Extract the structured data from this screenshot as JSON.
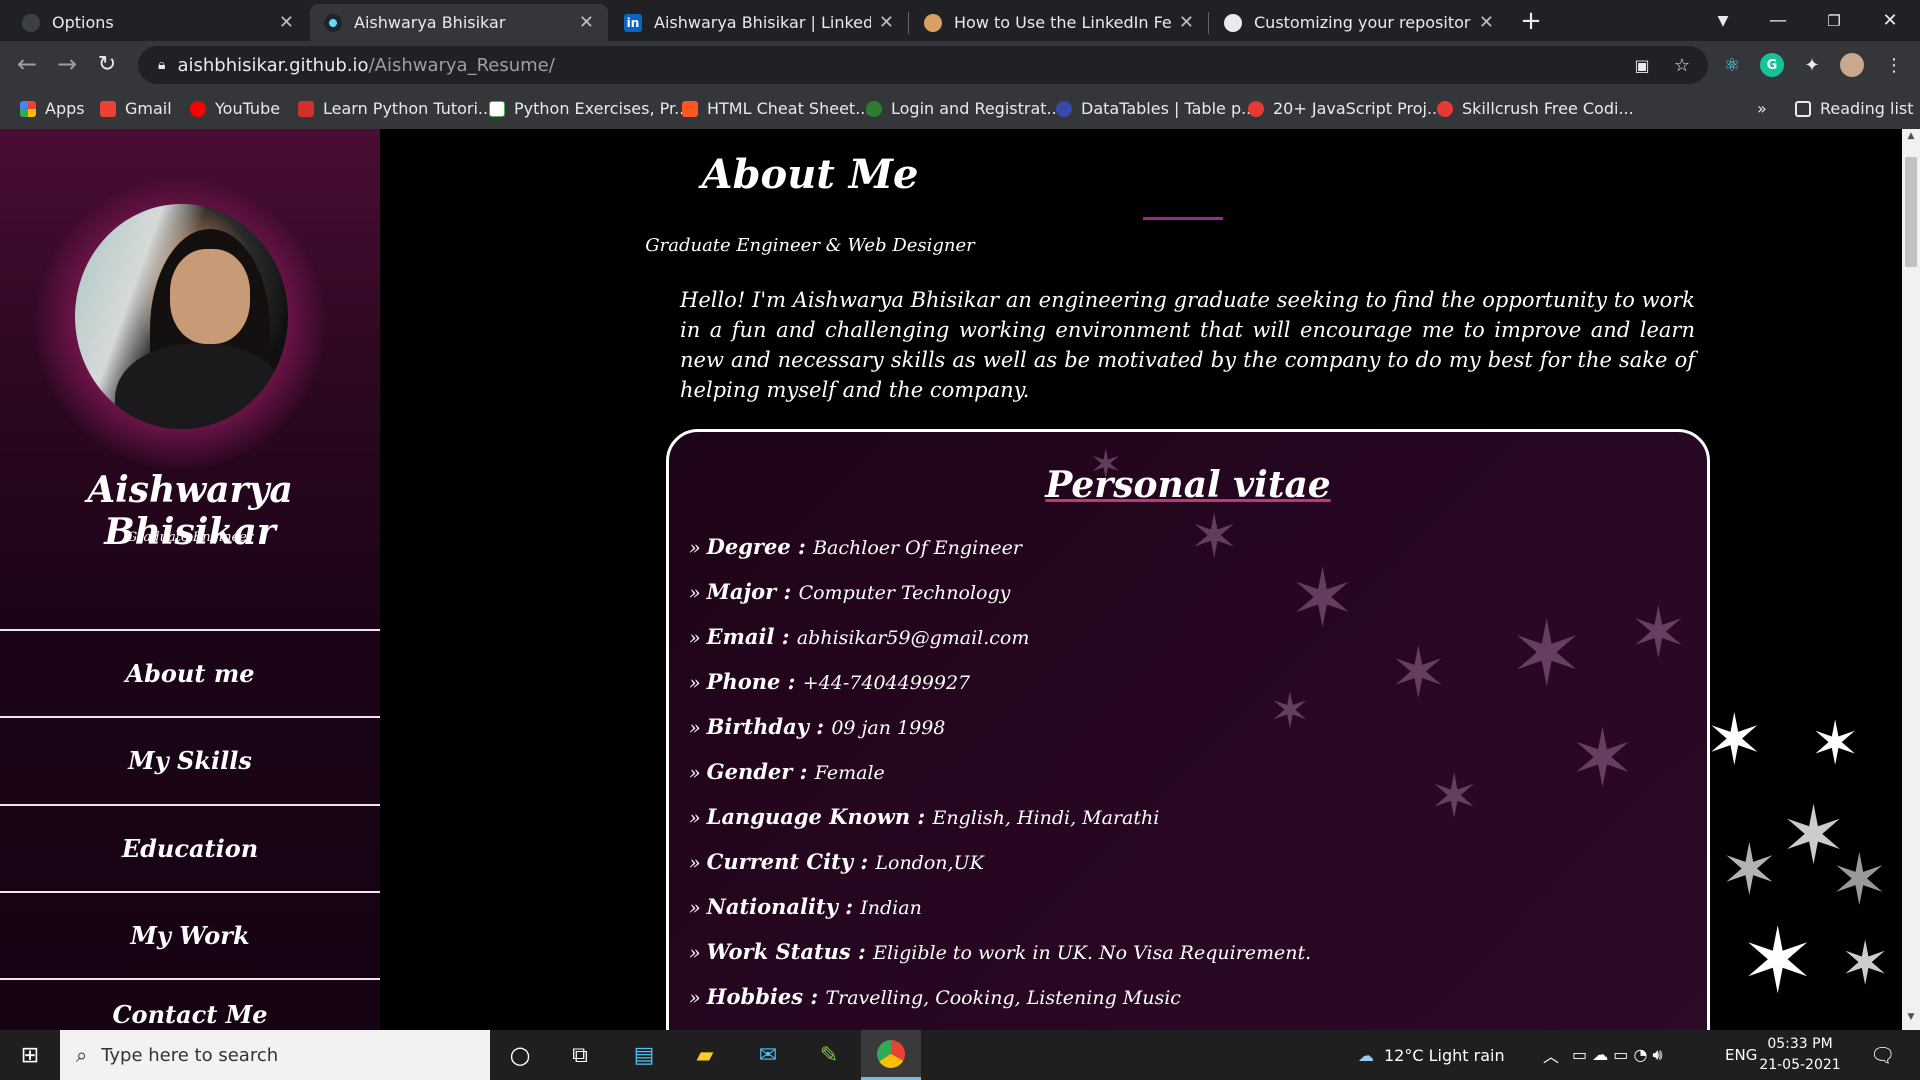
{
  "browser": {
    "tabs": [
      {
        "title": "Options",
        "favicon_color": "#3c4043",
        "active": false
      },
      {
        "title": "Aishwarya Bhisikar",
        "favicon_color": "#61dafb",
        "active": true
      },
      {
        "title": "Aishwarya Bhisikar | LinkedIn",
        "favicon_color": "#0a66c2",
        "active": false
      },
      {
        "title": "How to Use the LinkedIn Feature",
        "favicon_color": "#d9a066",
        "active": false
      },
      {
        "title": "Customizing your repository's so",
        "favicon_color": "#e8eaed",
        "active": false
      }
    ],
    "new_tab_icon": "plus-icon",
    "url_host": "aishbhisikar.github.io",
    "url_path": "/Aishwarya_Resume/",
    "bookmarks": [
      {
        "label": "Apps",
        "color": "#4285f4"
      },
      {
        "label": "Gmail",
        "color": "#ea4335"
      },
      {
        "label": "YouTube",
        "color": "#ff0000"
      },
      {
        "label": "Learn Python Tutori...",
        "color": "#d32f2f"
      },
      {
        "label": "Python Exercises, Pr...",
        "color": "#4caf50"
      },
      {
        "label": "HTML Cheat Sheet...",
        "color": "#ff5722"
      },
      {
        "label": "Login and Registrat...",
        "color": "#2e7d32"
      },
      {
        "label": "DataTables | Table p...",
        "color": "#3949ab"
      },
      {
        "label": "20+ JavaScript Proj...",
        "color": "#e53935"
      },
      {
        "label": "Skillcrush Free Codi...",
        "color": "#e53935"
      }
    ],
    "bookmarks_more": "»",
    "reading_list": "Reading list"
  },
  "sidebar": {
    "name": "Aishwarya Bhisikar",
    "role": "Graduate Engineer",
    "nav": [
      "About me",
      "My Skills",
      "Education",
      "My Work",
      "Contact Me"
    ]
  },
  "about": {
    "title": "About Me",
    "subtitle": "Graduate Engineer & Web Designer",
    "intro": "Hello! I'm Aishwarya Bhisikar an engineering graduate seeking to find the opportunity to work in a fun and challenging working environment that will encourage me to improve and learn new and necessary skills as well as be motivated by the company to do my best for the sake of helping myself and the company."
  },
  "vitae": {
    "title": "Personal vitae",
    "rows": [
      {
        "key": "Degree",
        "value": "Bachloer Of Engineer"
      },
      {
        "key": "Major",
        "value": "Computer Technology"
      },
      {
        "key": "Email",
        "value": "abhisikar59@gmail.com"
      },
      {
        "key": "Phone",
        "value": "+44-7404499927"
      },
      {
        "key": "Birthday",
        "value": "09 jan 1998"
      },
      {
        "key": "Gender",
        "value": "Female"
      },
      {
        "key": "Language Known",
        "value": "English, Hindi, Marathi"
      },
      {
        "key": "Current City",
        "value": "London,UK"
      },
      {
        "key": "Nationality",
        "value": "Indian"
      },
      {
        "key": "Work Status",
        "value": "Eligible to work in UK. No Visa Requirement."
      },
      {
        "key": "Hobbies",
        "value": "Travelling, Cooking, Listening Music"
      }
    ]
  },
  "taskbar": {
    "search_placeholder": "Type here to search",
    "weather": "12°C  Light rain",
    "language": "ENG",
    "time": "05:33 PM",
    "date": "21-05-2021"
  },
  "colors": {
    "accent": "#9a2a8a",
    "sidebar_top": "#4a0d33",
    "vitae_bg": "#250620"
  }
}
